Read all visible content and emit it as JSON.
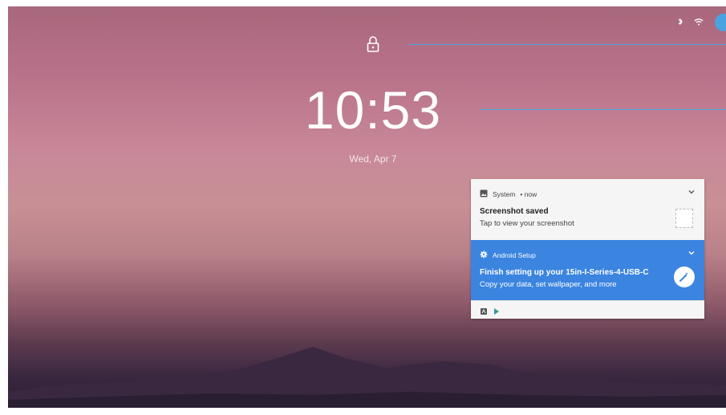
{
  "lockscreen": {
    "time": "10:53",
    "date": "Wed, Apr 7"
  },
  "status_bar": {
    "icons": [
      "bluetooth-icon",
      "network-icon",
      "user-avatar"
    ]
  },
  "notifications": [
    {
      "app": "System",
      "meta": "• now",
      "title": "Screenshot saved",
      "text": "Tap to view your screenshot",
      "icon": "image-icon"
    },
    {
      "app": "Android Setup",
      "meta": "",
      "title": "Finish setting up your 15in-I-Series-4-USB-C",
      "text": "Copy your data, set wallpaper, and more",
      "icon": "gear-icon"
    }
  ],
  "colors": {
    "accent": "#3b84e0",
    "line": "#4ea7e6"
  }
}
